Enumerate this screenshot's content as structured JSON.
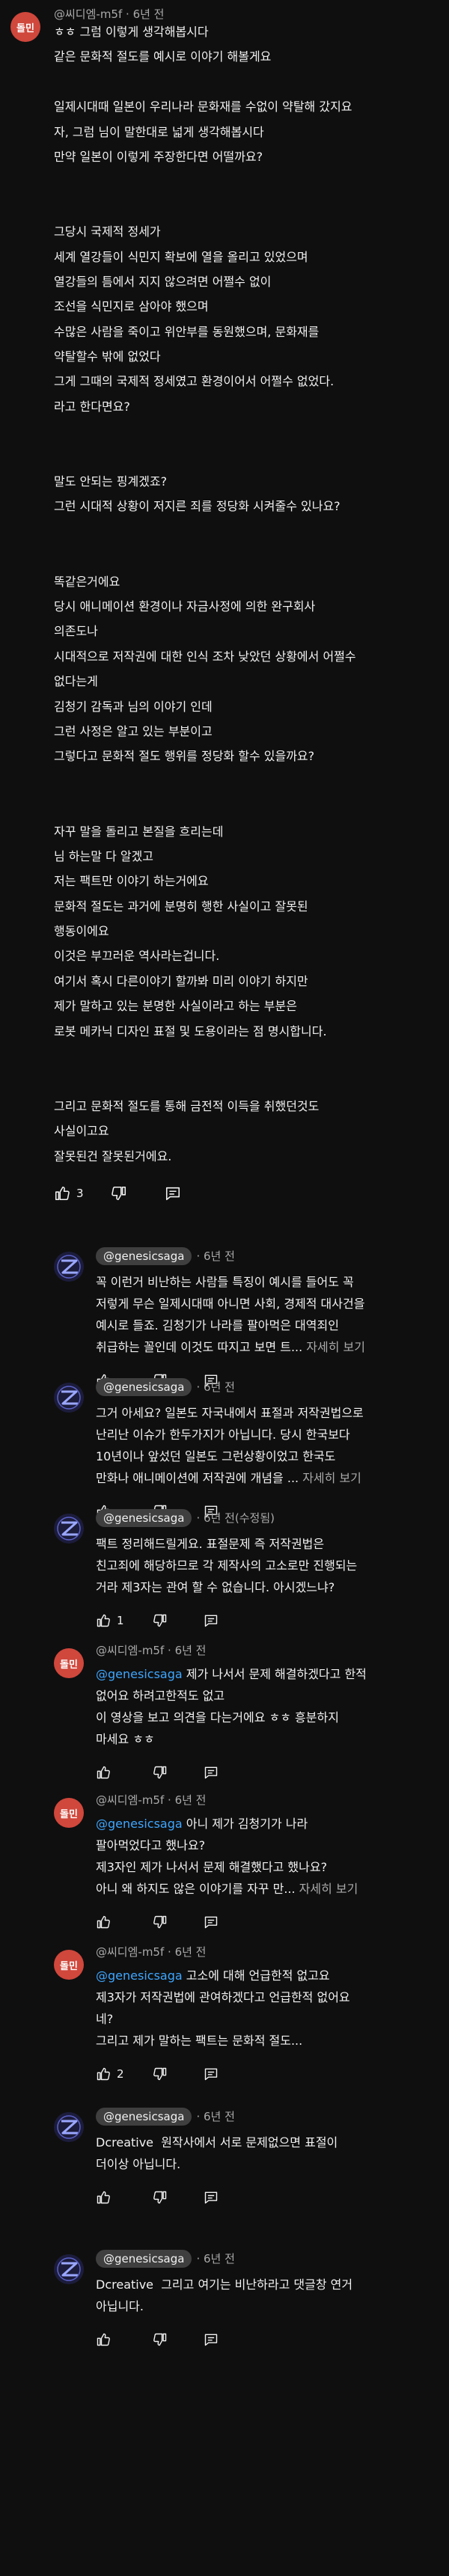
{
  "top_comment": {
    "avatar_text": "돌민",
    "author": "@씨디엠-m5f",
    "time": "6년 전",
    "lines": [
      "ㅎㅎ 그럼 이렇게 생각해봅시다",
      "같은 문화적 절도를 예시로 이야기 해볼게요",
      "",
      "일제시대때 일본이 우리나라 문화재를 수없이 약탈해 갔지요",
      "자, 그럼 님이 말한대로 넓게 생각해봅시다",
      "만약 일본이 이렇게 주장한다면 어떨까요?",
      "",
      "",
      "그당시 국제적 정세가",
      "세계 열강들이 식민지 확보에 열을 올리고 있었으며",
      "열강들의 틈에서 지지 않으려면 어쩔수 없이",
      "조선을 식민지로 삼아야 했으며",
      "수많은 사람을 죽이고 위안부를 동원했으며, 문화재를",
      "약탈할수 밖에 없었다",
      "그게 그때의 국제적 정세였고 환경이어서 어쩔수 없었다.",
      "라고 한다면요?",
      "",
      "",
      "말도 안되는 핑계겠죠?",
      "그런 시대적 상황이 저지른 죄를 정당화 시켜줄수 있나요?",
      "",
      "",
      "똑같은거에요",
      "당시 애니메이션 환경이나 자금사정에 의한 완구회사",
      "의존도나",
      "시대적으로 저작권에 대한 인식 조차 낮았던 상황에서 어쩔수",
      "없다는게",
      "김청기 감독과 님의 이야기 인데",
      "그런 사정은 알고 있는 부분이고",
      "그렇다고 문화적 절도 행위를 정당화 할수 있을까요?",
      "",
      "",
      "자꾸 말을 돌리고 본질을 흐리는데",
      "님 하는말 다 알겠고",
      "저는 팩트만 이야기 하는거에요",
      "문화적 절도는 과거에 분명히 행한 사실이고 잘못된",
      "행동이에요",
      "이것은 부끄러운 역사라는겁니다.",
      "여기서 혹시 다른이야기 할까봐 미리 이야기 하지만",
      "제가 말하고 있는 분명한 사실이라고 하는 부분은",
      "로봇 메카닉 디자인 표절 및 도용이라는 점 명시합니다.",
      "",
      "",
      "그리고 문화적 절도를 통해 금전적 이득을 취했던것도",
      "사실이고요",
      "잘못된건 잘못된거에요."
    ],
    "likes": "3"
  },
  "replies": [
    {
      "avatar": "gs",
      "author": "@genesicsaga",
      "author_pill": true,
      "time": "6년 전",
      "mention": "",
      "lines": [
        "꼭 이런거 비난하는 사람들 특징이 예시를 들어도 꼭",
        "저렇게 무슨 일제시대때 아니면 사회, 경제적 대사건을",
        "예시로 들죠. 김청기가 나라를 팔아먹은 대역죄인"
      ],
      "last_line": "취급하는 꼴인데 이것도 따지고 보면 트...",
      "more": "자세히 보기",
      "likes": ""
    },
    {
      "avatar": "gs",
      "author": "@genesicsaga",
      "author_pill": true,
      "time": "6년 전",
      "mention": "",
      "lines": [
        "그거 아세요? 일본도 자국내에서 표절과 저작권법으로",
        "난리난 이슈가 한두가지가 아닙니다. 당시 한국보다",
        "10년이나 앞섰던 일본도 그런상황이었고 한국도"
      ],
      "last_line": "만화나 애니메이션에 저작권에 개념을 ...",
      "more": "자세히 보기",
      "likes": ""
    },
    {
      "avatar": "gs",
      "author": "@genesicsaga",
      "author_pill": true,
      "time": "6년 전(수정됨)",
      "mention": "",
      "lines": [
        "팩트 정리해드릴게요. 표절문제 즉 저작권법은",
        "친고죄에 해당하므로 각 제작사의 고소로만 진행되는",
        "거라 제3자는 관여 할 수 없습니다. 아시겠느냐?"
      ],
      "last_line": "",
      "more": "",
      "likes": "1"
    },
    {
      "avatar": "dm",
      "avatar_text": "돌민",
      "author": "@씨디엠-m5f",
      "author_pill": false,
      "time": "6년 전",
      "mention": "@genesicsaga",
      "first_rest": " 제가 나서서 문제 해결하겠다고 한적",
      "lines": [
        "없어요 하려고한적도 없고",
        "이 영상을 보고 의견을 다는거에요 ㅎㅎ 흥분하지",
        "마세요 ㅎㅎ"
      ],
      "last_line": "",
      "more": "",
      "likes": ""
    },
    {
      "avatar": "dm",
      "avatar_text": "돌민",
      "author": "@씨디엠-m5f",
      "author_pill": false,
      "time": "6년 전",
      "mention": "@genesicsaga",
      "first_rest": " 아니 제가 김청기가 나라",
      "lines": [
        "팔아먹었다고 했나요?",
        "제3자인 제가 나서서 문제 해결했다고 했나요?"
      ],
      "last_line": "아니 왜 하지도 않은 이야기를 자꾸 만...",
      "more": "자세히 보기",
      "likes": ""
    },
    {
      "avatar": "dm",
      "avatar_text": "돌민",
      "author": "@씨디엠-m5f",
      "author_pill": false,
      "time": "6년 전",
      "mention": "@genesicsaga",
      "first_rest": " 고소에 대해 언급한적 없고요",
      "lines": [
        "제3자가 저작권법에 관여하겠다고 언급한적 없어요",
        "네?",
        "그리고 제가 말하는 팩트는 문화적 절도..."
      ],
      "last_line": "",
      "more": "",
      "likes": "2"
    },
    {
      "avatar": "gs",
      "author": "@genesicsaga",
      "author_pill": true,
      "time": "6년 전",
      "mention": "",
      "lines": [
        "Dcreative  원작사에서 서로 문제없으면 표절이",
        "더이상 아닙니다."
      ],
      "last_line": "",
      "more": "",
      "likes": ""
    },
    {
      "avatar": "gs",
      "author": "@genesicsaga",
      "author_pill": true,
      "time": "6년 전",
      "mention": "",
      "lines": [
        "Dcreative  그리고 여기는 비난하라고 댓글창 연거",
        "아닙니다."
      ],
      "last_line": "",
      "more": "",
      "likes": ""
    }
  ]
}
